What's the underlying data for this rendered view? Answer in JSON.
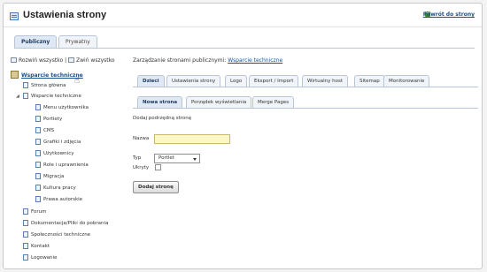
{
  "header": {
    "title": "Ustawienia strony",
    "back_label": "Powrót do strony"
  },
  "page_tabs": [
    "Publiczny",
    "Prywatny"
  ],
  "tree_tools": {
    "expand": "Rozwiń wszystko",
    "separator": "|",
    "collapse": "Zwiń wszystko"
  },
  "tree": {
    "root": "Wsparcie techniczne",
    "items": [
      "Strona główna",
      "Wsparcie techniczne",
      "Menu użytkownika",
      "Portlety",
      "CMS",
      "Grafiki i zdjęcia",
      "Użytkownicy",
      "Role i uprawnienia",
      "Migracja",
      "Kultura pracy",
      "Prawa autorskie",
      "Forum",
      "Dokumentacja/Pliki do pobrania",
      "Społeczności techniczne",
      "Kontakt",
      "Logowanie"
    ]
  },
  "manage": {
    "prefix": "Zarządzanie stronami publicznymi:",
    "link": "Wsparcie techniczne"
  },
  "main_tabs": [
    "Dzieci",
    "Ustawienia strony",
    "Logo",
    "Eksport / Import",
    "Wirtualny host",
    "Sitemap",
    "Monitorowanie"
  ],
  "sub_tabs": [
    "Nowa strona",
    "Porządek wyświetlania",
    "Merge Pages"
  ],
  "form": {
    "heading": "Dodaj podrzędną stronę",
    "name_label": "Nazwa",
    "name_value": "",
    "type_label": "Typ",
    "type_value": "Portlet",
    "hidden_label": "Ukryty",
    "submit_label": "Dodaj stronę"
  },
  "colors": {
    "accent": "#1c4f8f",
    "input_highlight": "#fdf7c8"
  },
  "icons": [
    "page-icon",
    "root-site-icon",
    "back-icon",
    "expand-icon",
    "collapse-icon",
    "cursor-hand-icon"
  ]
}
